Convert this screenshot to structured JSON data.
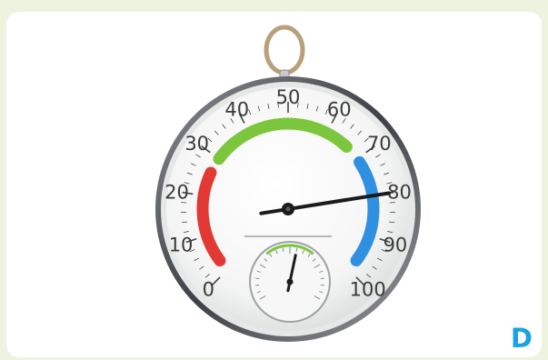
{
  "panel_label": "D",
  "colors": {
    "page_background": "#eef3df",
    "zone_red": "#e13a34",
    "zone_green": "#7cc63d",
    "zone_blue": "#2f8fe0",
    "needle": "#1b1b1b"
  },
  "hygrometer": {
    "scale_labels": [
      "0",
      "10",
      "20",
      "30",
      "40",
      "50",
      "60",
      "70",
      "80",
      "90",
      "100"
    ],
    "reading_percent": 80
  },
  "thermometer": {
    "reading_fraction": 0.55
  },
  "icons": [
    "hanging-ring-icon"
  ]
}
